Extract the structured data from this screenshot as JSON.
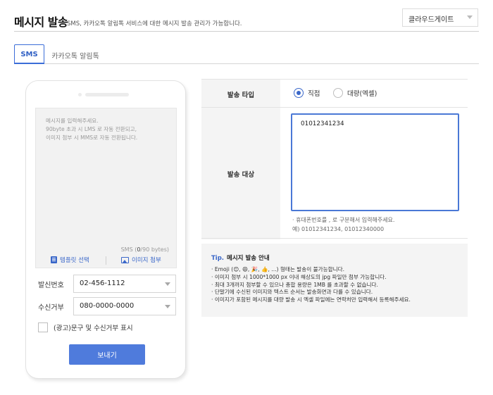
{
  "header": {
    "title": "메시지 발송",
    "subtitle": "SMS, 카카오톡 알림톡 서비스에 대한 메시지 발송 관리가 가능합니다.",
    "company_select": "클라우드게이트"
  },
  "tabs": [
    {
      "label": "SMS",
      "active": true
    },
    {
      "label": "카카오톡 알림톡",
      "active": false
    }
  ],
  "composer": {
    "placeholder": "메시지를 입력해주세요.\n90byte 초과 시 LMS 로 자동 전환되고,\n이미지 첨부 시 MMS로 자동 전환됩니다.",
    "byte_prefix": "SMS (",
    "byte_count": "0",
    "byte_suffix": "/90 bytes)",
    "template_label": "템플릿 선택",
    "image_label": "이미지 첨부"
  },
  "sender": {
    "label": "발신번호",
    "value": "02-456-1112"
  },
  "reject": {
    "label": "수신거부",
    "value": "080-0000-0000"
  },
  "ad": {
    "label": "(광고)문구 및 수신거부 표시",
    "checked": false
  },
  "send_button": "보내기",
  "send_type": {
    "label": "발송 타입",
    "options": [
      {
        "label": "직접",
        "selected": true
      },
      {
        "label": "대량(엑셀)",
        "selected": false
      }
    ]
  },
  "target": {
    "label": "발송 대상",
    "value": "01012341234",
    "hint_line1": "· 휴대폰번호를 , 로 구분해서 입력해주세요.",
    "hint_line2": "예) 01012341234, 01012340000"
  },
  "tip": {
    "lead": "Tip.",
    "title": "메시지 발송 안내",
    "items": [
      "· Emoji (😊, 😄, 🎉, 👍, ...) 형태는 발송이 불가능합니다.",
      "· 이미지 첨부 시 1000*1000 px 이내 해상도의 jpg 파일만 첨부 가능합니다.",
      "· 최대 3개까지 첨부할 수 있으나 총합 용량은 1MB 를 초과할 수 없습니다.",
      "· 단말기에 수신된 이미지와 텍스트 순서는 발송화면과 다를 수 있습니다.",
      "· 이미지가 포함된 메시지를 대량 발송 시 엑셀 파일에는 연락처만 입력해서 등록해주세요."
    ]
  },
  "colors": {
    "accent": "#3a67c9",
    "button": "#4f7bdc"
  }
}
